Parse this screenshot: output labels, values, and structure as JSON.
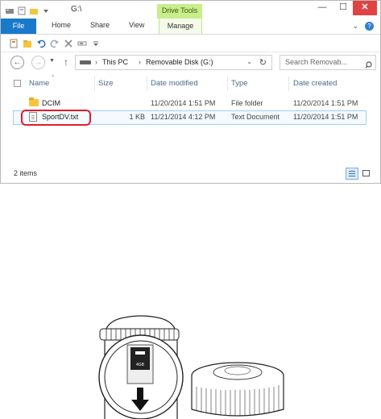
{
  "window": {
    "title": "G:\\",
    "contextual_tab_header": "Drive Tools",
    "controls": {
      "minimize": "—",
      "maximize": "☐",
      "close": "✕"
    }
  },
  "ribbon": {
    "tabs": [
      "File",
      "Home",
      "Share",
      "View",
      "Manage"
    ],
    "active_tab": "File",
    "expand_glyph": "⌄",
    "help_glyph": "?"
  },
  "nav": {
    "back_glyph": "←",
    "forward_glyph": "→",
    "recent_glyph": "▼",
    "up_glyph": "↑",
    "breadcrumb": [
      "This PC",
      "Removable Disk (G:)"
    ],
    "crumb_separator": "›",
    "dropdown_glyph": "⌄",
    "refresh_glyph": "↻",
    "search_placeholder": "Search Removab..."
  },
  "columns": {
    "name": "Name",
    "size": "Size",
    "date_modified": "Date modified",
    "type": "Type",
    "date_created": "Date created",
    "sort_glyph": "^"
  },
  "files": [
    {
      "name": "DCIM",
      "size": "",
      "date_modified": "11/20/2014 1:51 PM",
      "type": "File folder",
      "date_created": "11/20/2014 1:51 PM",
      "icon": "folder-icon"
    },
    {
      "name": "SportDV.txt",
      "size": "1 KB",
      "date_modified": "11/21/2014 4:12 PM",
      "type": "Text Document",
      "date_created": "11/20/2014 1:51 PM",
      "icon": "text-file-icon"
    }
  ],
  "selected_file": "SportDV.txt",
  "status": {
    "item_count": "2 items"
  },
  "colors": {
    "file_tab": "#1979ca",
    "drive_tools": "#c8ed8b",
    "highlight_ring": "#e21c2b",
    "close_button": "#e04343"
  },
  "illustration": {
    "subject": "camera-with-microsd-slot-and-lens-cap",
    "card_label": "4GB"
  }
}
